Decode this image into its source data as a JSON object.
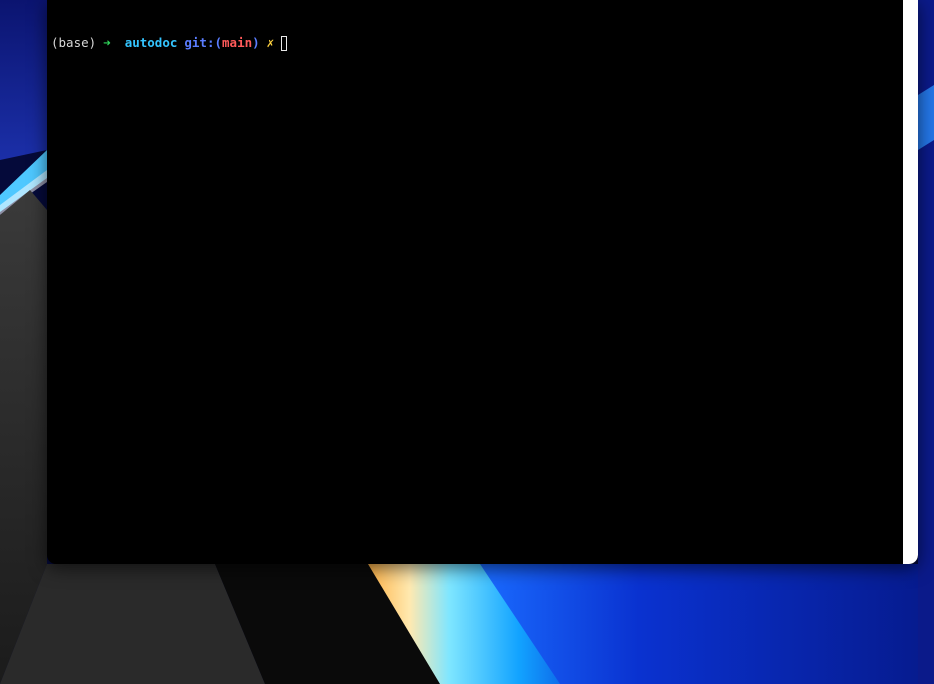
{
  "terminal": {
    "prompt": {
      "env": "(base)",
      "arrow": "➜",
      "directory": "autodoc",
      "git_prefix": "git:(",
      "branch": "main",
      "git_suffix": ")",
      "dirty_marker": "✗"
    }
  },
  "colors": {
    "terminal_bg": "#000000",
    "env_text": "#d8d8d8",
    "arrow": "#2fd65a",
    "directory": "#34c5ff",
    "git": "#5a7dff",
    "branch": "#ff5a5a",
    "dirty_marker": "#ffd23f",
    "wallpaper_blue": "#0a1fa8"
  }
}
